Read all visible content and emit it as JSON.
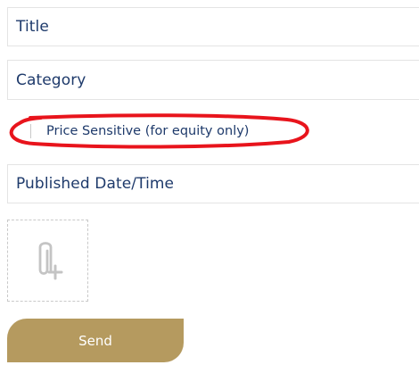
{
  "form": {
    "title_field": {
      "placeholder": "Title"
    },
    "category_field": {
      "placeholder": "Category"
    },
    "price_sensitive": {
      "label": "Price Sensitive (for equity only)",
      "checked": false
    },
    "published_field": {
      "placeholder": "Published Date/Time"
    },
    "attachment": {
      "icon": "paperclip-plus-icon"
    },
    "send_button": {
      "label": "Send"
    }
  },
  "colors": {
    "text": "#1e3a6b",
    "field_border": "#e4e4e4",
    "button": "#b59a5f",
    "highlight_oval": "#e8141c",
    "dashed_border": "#c9c9c9"
  }
}
